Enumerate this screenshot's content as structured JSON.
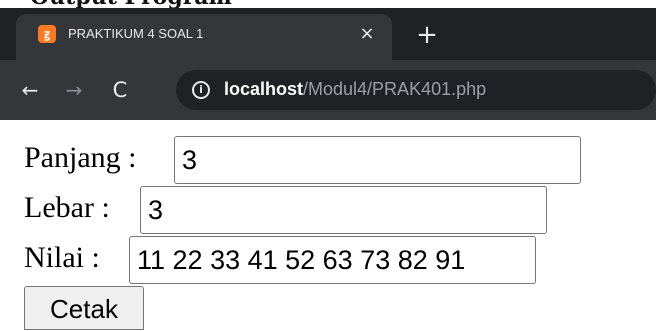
{
  "header": {
    "title": "Output Program"
  },
  "browser": {
    "tab": {
      "favicon_text": "ꙃ",
      "title": "PRAKTIKUM 4 SOAL 1",
      "close": "×"
    },
    "new_tab": "+",
    "nav": {
      "back": "←",
      "forward": "→",
      "reload": "C"
    },
    "address": {
      "info": "i",
      "host": "localhost",
      "path": "/Modul4/PRAK401.php"
    }
  },
  "form": {
    "panjang": {
      "label": "Panjang :",
      "value": "3"
    },
    "lebar": {
      "label": "Lebar :",
      "value": "3"
    },
    "nilai": {
      "label": "Nilai :",
      "value": "11 22 33 41 52 63 73 82 91"
    },
    "submit": "Cetak"
  }
}
